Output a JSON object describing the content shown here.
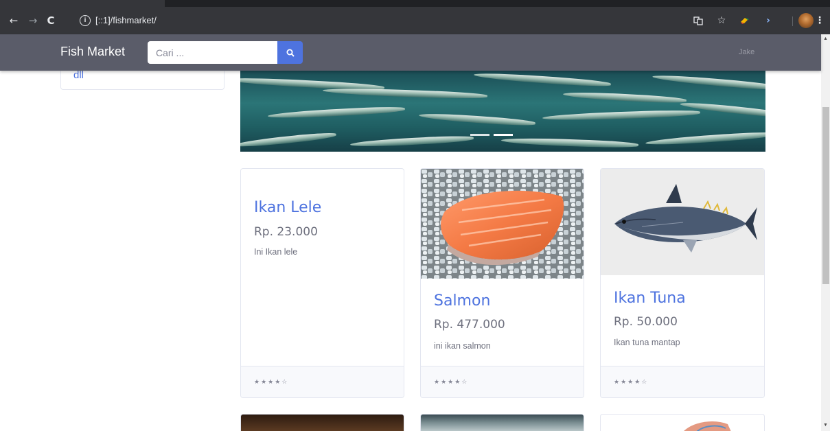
{
  "browser": {
    "url": "[::1]/fishmarket/",
    "icons": [
      "back-icon",
      "forward-icon",
      "reload-icon",
      "info-icon",
      "translate-icon",
      "star-icon",
      "extension-icon",
      "chevron-right-icon",
      "profile-avatar",
      "menu-dots-icon"
    ]
  },
  "navbar": {
    "brand": "Fish Market",
    "search_placeholder": "Cari ...",
    "user": "Jake"
  },
  "sidebar": {
    "items": [
      {
        "label": "dll"
      }
    ]
  },
  "products": [
    {
      "name": "Ikan Lele",
      "price": "Rp. 23.000",
      "description": "Ini Ikan lele",
      "rating": "★★★★☆",
      "image": "none"
    },
    {
      "name": "Salmon",
      "price": "Rp. 477.000",
      "description": "ini ikan salmon",
      "rating": "★★★★☆",
      "image": "salmon-fillet-on-ice"
    },
    {
      "name": "Ikan Tuna",
      "price": "Rp. 50.000",
      "description": "Ikan tuna mantap",
      "rating": "★★★★☆",
      "image": "tuna-illustration"
    }
  ],
  "colors": {
    "navbar": "#5a5c69",
    "primary": "#4e73df",
    "text": "#6e707e",
    "card_footer": "#f8f9fc"
  }
}
